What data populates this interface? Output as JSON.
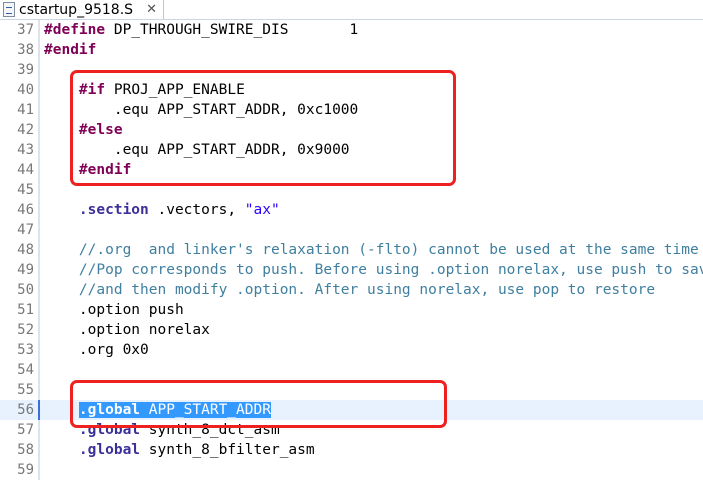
{
  "tab": {
    "title": "cstartup_9518.S",
    "close": "✕"
  },
  "lines": [
    {
      "n": "37",
      "parts": [
        {
          "t": "#define",
          "c": "kw"
        },
        {
          "t": " DP_THROUGH_SWIRE_DIS       1",
          "c": ""
        }
      ]
    },
    {
      "n": "38",
      "parts": [
        {
          "t": "#endif",
          "c": "kw"
        }
      ]
    },
    {
      "n": "39",
      "parts": []
    },
    {
      "n": "40",
      "parts": [
        {
          "t": "    ",
          "c": ""
        },
        {
          "t": "#if",
          "c": "kw"
        },
        {
          "t": " PROJ_APP_ENABLE",
          "c": ""
        }
      ]
    },
    {
      "n": "41",
      "parts": [
        {
          "t": "        .equ APP_START_ADDR, 0xc1000",
          "c": ""
        }
      ]
    },
    {
      "n": "42",
      "parts": [
        {
          "t": "    ",
          "c": ""
        },
        {
          "t": "#else",
          "c": "kw"
        }
      ]
    },
    {
      "n": "43",
      "parts": [
        {
          "t": "        .equ APP_START_ADDR, 0x9000",
          "c": ""
        }
      ]
    },
    {
      "n": "44",
      "parts": [
        {
          "t": "    ",
          "c": ""
        },
        {
          "t": "#endif",
          "c": "kw"
        }
      ]
    },
    {
      "n": "45",
      "parts": []
    },
    {
      "n": "46",
      "parts": [
        {
          "t": "    ",
          "c": ""
        },
        {
          "t": ".section",
          "c": "dir"
        },
        {
          "t": " .vectors, ",
          "c": ""
        },
        {
          "t": "\"ax\"",
          "c": "str"
        }
      ]
    },
    {
      "n": "47",
      "parts": []
    },
    {
      "n": "48",
      "parts": [
        {
          "t": "    //.org  and linker's relaxation (-flto) cannot be used at the same time",
          "c": "cmt"
        }
      ]
    },
    {
      "n": "49",
      "parts": [
        {
          "t": "    //Pop corresponds to push. Before using .option norelax, use push to save",
          "c": "cmt"
        }
      ]
    },
    {
      "n": "50",
      "parts": [
        {
          "t": "    //and then modify .option. After using norelax, use pop to restore",
          "c": "cmt"
        }
      ]
    },
    {
      "n": "51",
      "parts": [
        {
          "t": "    .option push",
          "c": ""
        }
      ]
    },
    {
      "n": "52",
      "parts": [
        {
          "t": "    .option norelax",
          "c": ""
        }
      ]
    },
    {
      "n": "53",
      "parts": [
        {
          "t": "    .org 0x0",
          "c": ""
        }
      ]
    },
    {
      "n": "54",
      "parts": []
    },
    {
      "n": "55",
      "parts": []
    },
    {
      "n": "56",
      "current": true,
      "parts": [
        {
          "t": "    ",
          "c": ""
        },
        {
          "t": ".global",
          "c": "dir",
          "sel": true
        },
        {
          "t": " APP_START_ADDR",
          "c": "",
          "sel": true
        }
      ]
    },
    {
      "n": "57",
      "parts": [
        {
          "t": "    ",
          "c": ""
        },
        {
          "t": ".global",
          "c": "dir"
        },
        {
          "t": " synth_8_dct_asm",
          "c": ""
        }
      ]
    },
    {
      "n": "58",
      "parts": [
        {
          "t": "    ",
          "c": ""
        },
        {
          "t": ".global",
          "c": "dir"
        },
        {
          "t": " synth_8_bfilter_asm",
          "c": ""
        }
      ]
    },
    {
      "n": "59",
      "parts": []
    }
  ],
  "annotations": [
    {
      "label": "highlight-preprocessor-block"
    },
    {
      "label": "highlight-global-app-start-addr"
    }
  ]
}
